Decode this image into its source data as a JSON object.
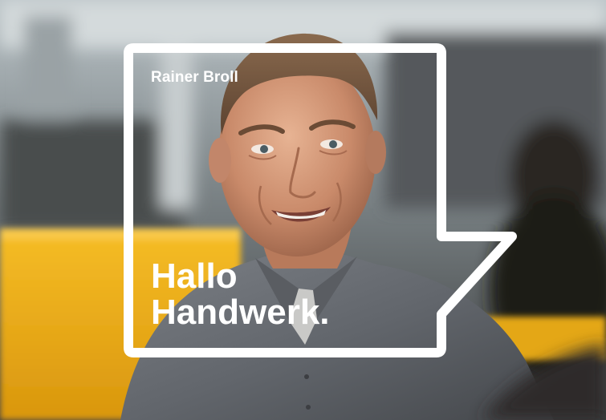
{
  "person": {
    "name": "Rainer Broll"
  },
  "headline": {
    "line1": "Hallo",
    "line2": "Handwerk."
  },
  "colors": {
    "frame": "#ffffff",
    "text": "#ffffff",
    "accent_yellow": "#f2b51f",
    "shirt": "#6d7076"
  }
}
